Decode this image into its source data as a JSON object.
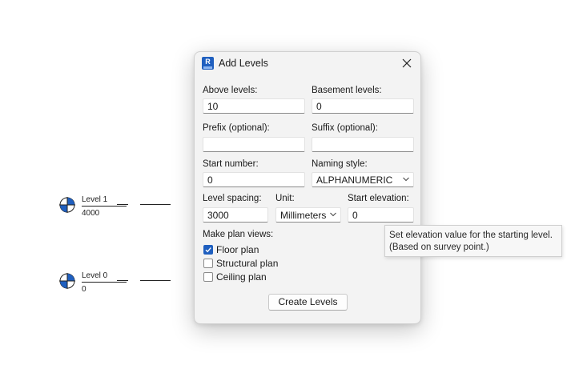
{
  "levels": [
    {
      "name": "Level 1",
      "elevation": "4000"
    },
    {
      "name": "Level 0",
      "elevation": "0"
    }
  ],
  "dialog": {
    "title": "Add Levels",
    "app_icon_letter": "R",
    "above_levels": {
      "label": "Above levels:",
      "value": "10"
    },
    "basement_levels": {
      "label": "Basement levels:",
      "value": "0"
    },
    "prefix": {
      "label": "Prefix (optional):",
      "value": ""
    },
    "suffix": {
      "label": "Suffix (optional):",
      "value": ""
    },
    "start_number": {
      "label": "Start number:",
      "value": "0"
    },
    "naming_style": {
      "label": "Naming style:",
      "value": "ALPHANUMERIC"
    },
    "level_spacing": {
      "label": "Level spacing:",
      "value": "3000"
    },
    "unit": {
      "label": "Unit:",
      "value": "Millimeters"
    },
    "start_elevation": {
      "label": "Start elevation:",
      "value": "0"
    },
    "plan_views": {
      "label": "Make plan views:",
      "options": [
        {
          "label": "Floor plan",
          "checked": true
        },
        {
          "label": "Structural plan",
          "checked": false
        },
        {
          "label": "Ceiling plan",
          "checked": false
        }
      ]
    },
    "create_button": "Create Levels"
  },
  "tooltip": {
    "line1": "Set elevation value for the starting level.",
    "line2": "(Based on survey point.)"
  },
  "colors": {
    "accent": "#1f5fbf",
    "level_head_blue": "#1f5fbf"
  }
}
